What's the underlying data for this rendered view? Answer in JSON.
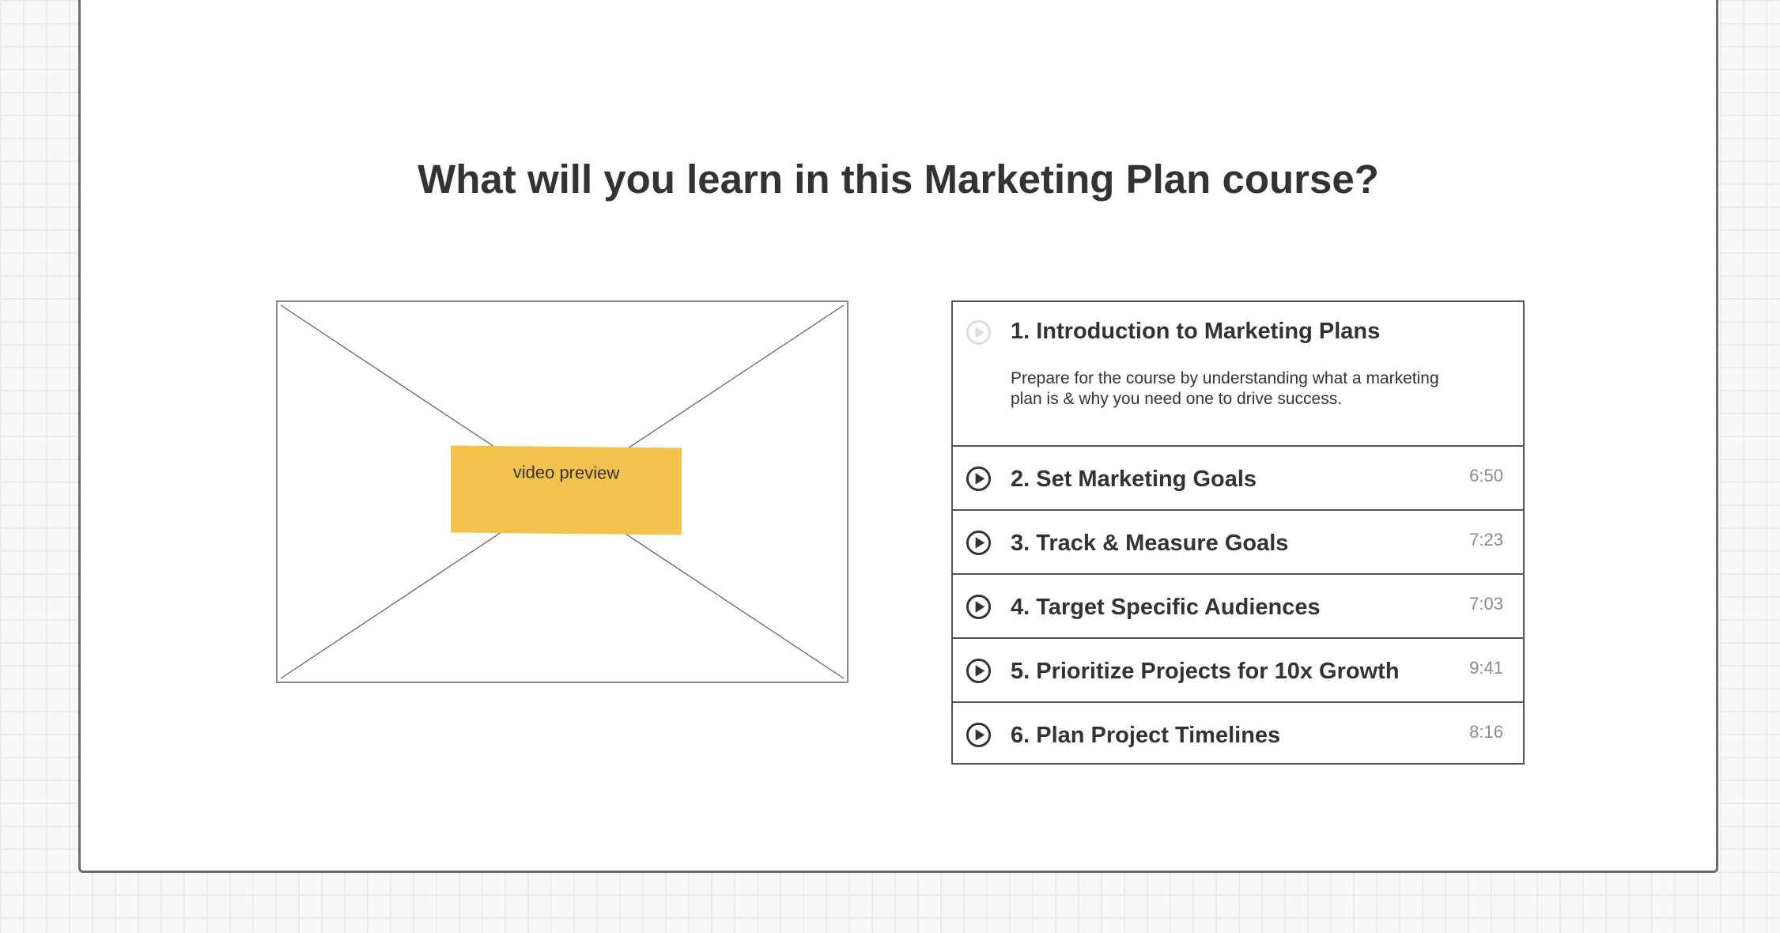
{
  "heading": "What will you learn in this Marketing Plan course?",
  "video": {
    "label": "video preview"
  },
  "lessons": [
    {
      "title": "1. Introduction to Marketing Plans",
      "description": "Prepare for the course by understanding what a marketing plan is & why you need one to drive success.",
      "duration": "",
      "icon": "play-circle-icon",
      "state": "expanded"
    },
    {
      "title": "2. Set Marketing Goals",
      "duration": "6:50",
      "icon": "play-circle-icon"
    },
    {
      "title": "3. Track & Measure Goals",
      "duration": "7:23",
      "icon": "play-circle-icon"
    },
    {
      "title": "4. Target Specific Audiences",
      "duration": "7:03",
      "icon": "play-circle-icon"
    },
    {
      "title": "5. Prioritize Projects for 10x Growth",
      "duration": "9:41",
      "icon": "play-circle-icon"
    },
    {
      "title": "6. Plan Project Timelines",
      "duration": "8:16",
      "icon": "play-circle-icon"
    }
  ],
  "colors": {
    "video_label_bg": "#f2c24c",
    "text": "#333333",
    "duration_text": "#8a8a8a",
    "active_icon": "#333333",
    "inactive_icon": "#dddddd"
  }
}
